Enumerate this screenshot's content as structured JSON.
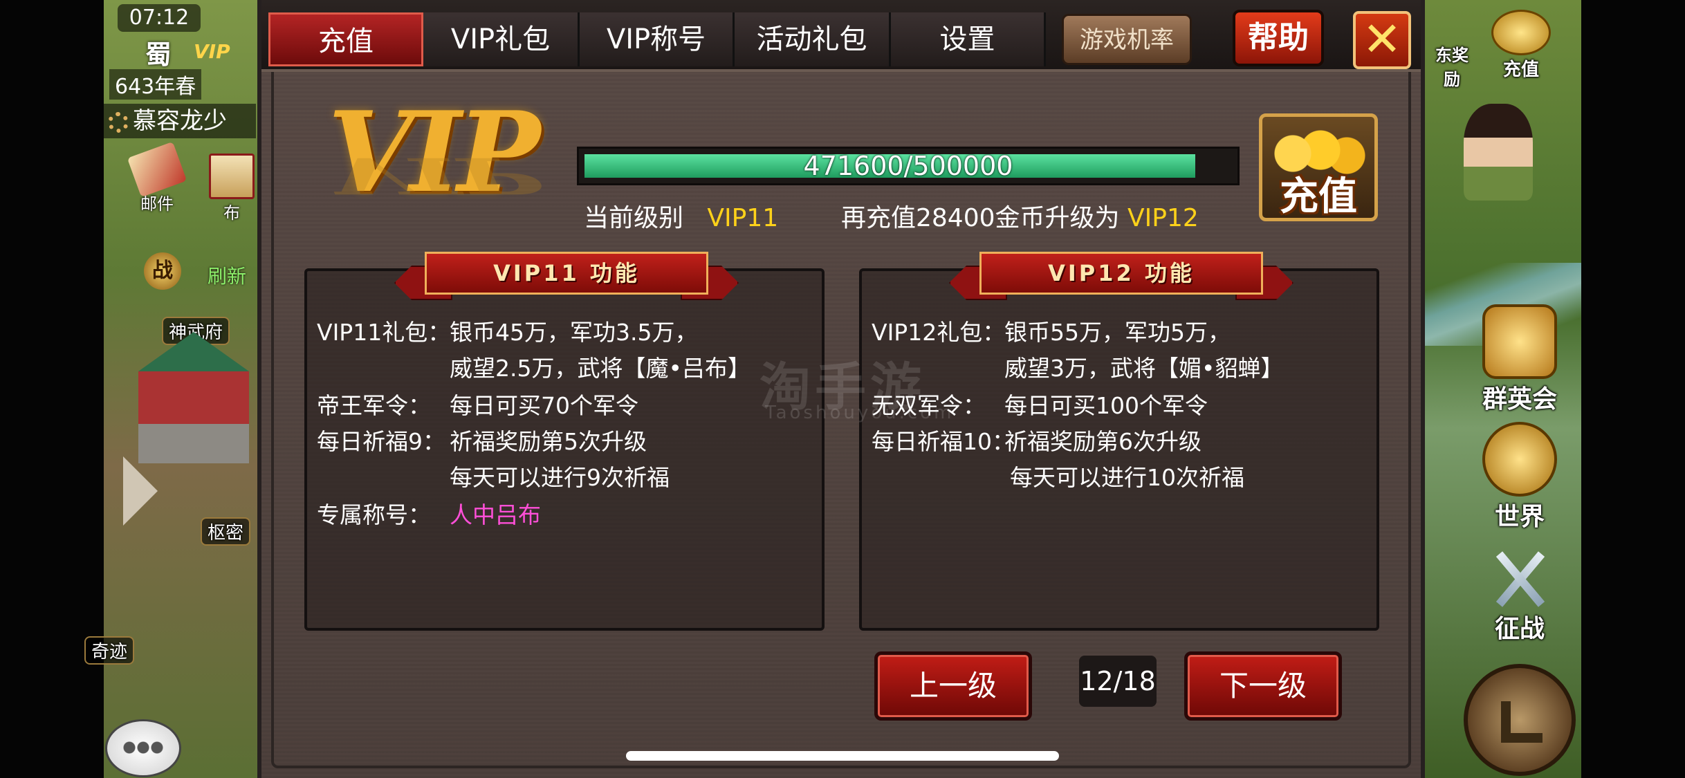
{
  "hud_left": {
    "time": "07:12",
    "nation": "蜀",
    "vip_tag": "VIP",
    "year": "643年春",
    "player_name": "慕容龙少",
    "mail_label": "邮件",
    "board_label": "布",
    "war_label": "战",
    "refresh_label": "刷新",
    "shenwufu_label": "神武府",
    "shumi_label": "枢密",
    "qiji_label": "奇迹"
  },
  "hud_right": {
    "reward_label": "东奖励",
    "recharge_label": "充值",
    "heroes_label": "群英会",
    "world_label": "世界",
    "campaign_label": "征战"
  },
  "tabs": [
    {
      "label": "充值",
      "active": true
    },
    {
      "label": "VIP礼包",
      "active": false
    },
    {
      "label": "VIP称号",
      "active": false
    },
    {
      "label": "活动礼包",
      "active": false
    },
    {
      "label": "设置",
      "active": false
    }
  ],
  "odds_button": "游戏机率",
  "help_button": "帮助",
  "close_button": "✕",
  "vip_logo": "VIP",
  "progress": {
    "current": 471600,
    "target": 500000,
    "text": "471600/500000"
  },
  "level_info": {
    "current_label": "当前级别",
    "current_value": "VIP11",
    "upgrade_prefix": "再充值28400金币升级为",
    "upgrade_target": "VIP12"
  },
  "buy_button": "充值",
  "panels": [
    {
      "title": "VIP11  功能",
      "rows": [
        {
          "label": "VIP11礼包：",
          "lines": [
            "银币45万，军功3.5万，",
            "威望2.5万，武将【魔•吕布】"
          ]
        },
        {
          "label": "帝王军令：",
          "lines": [
            "每日可买70个军令"
          ]
        },
        {
          "label": "每日祈福9：",
          "lines": [
            "祈福奖励第5次升级",
            "每天可以进行9次祈福"
          ]
        },
        {
          "label": "专属称号：",
          "lines": [
            "人中吕布"
          ]
        }
      ]
    },
    {
      "title": "VIP12  功能",
      "rows": [
        {
          "label": "VIP12礼包：",
          "lines": [
            "银币55万，军功5万，",
            "威望3万，武将【媚•貂蝉】"
          ]
        },
        {
          "label": "无双军令：",
          "lines": [
            "每日可买100个军令"
          ]
        },
        {
          "label": "每日祈福10：",
          "lines": [
            "祈福奖励第6次升级",
            "每天可以进行10次祈福"
          ]
        }
      ]
    }
  ],
  "watermark": {
    "main": "淘手游",
    "sub": "Taoshouyou.com"
  },
  "nav": {
    "prev_label": "上一级",
    "next_label": "下一级",
    "page_indicator": "12/18"
  },
  "colors": {
    "accent_yellow": "#ffd21a",
    "title_pink": "#ff4fd8",
    "progress_green": "#3fc47e",
    "tab_active_red": "#b32424"
  }
}
